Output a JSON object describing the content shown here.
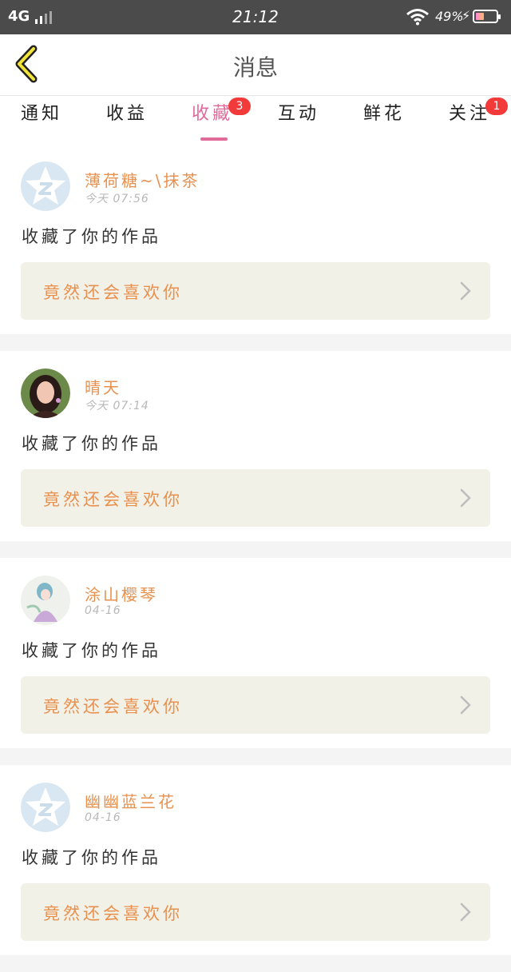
{
  "status_bar": {
    "network": "4G",
    "time": "21:12",
    "battery_percent": "49%",
    "battery_level": 0.49
  },
  "header": {
    "title": "消息",
    "back_icon": "back-chevron-icon"
  },
  "tabs": [
    {
      "label": "通知",
      "active": false,
      "badge": ""
    },
    {
      "label": "收益",
      "active": false,
      "badge": ""
    },
    {
      "label": "收藏",
      "active": true,
      "badge": "3"
    },
    {
      "label": "互动",
      "active": false,
      "badge": ""
    },
    {
      "label": "鲜花",
      "active": false,
      "badge": ""
    },
    {
      "label": "关注",
      "active": false,
      "badge": "1"
    }
  ],
  "colors": {
    "accent": "#e06a9a",
    "name_orange": "#e8914f",
    "badge_red": "#f23a3a",
    "link_bg": "#f2f1e8"
  },
  "feed": [
    {
      "user": "薄荷糖~\\抹茶",
      "time": "今天 07:56",
      "action": "收藏了你的作品",
      "work_title": "竟然还会喜欢你",
      "avatar": "default-star-avatar"
    },
    {
      "user": "晴天",
      "time": "今天 07:14",
      "action": "收藏了你的作品",
      "work_title": "竟然还会喜欢你",
      "avatar": "photo-avatar"
    },
    {
      "user": "涂山樱琴",
      "time": "04-16",
      "action": "收藏了你的作品",
      "work_title": "竟然还会喜欢你",
      "avatar": "anime-avatar"
    },
    {
      "user": "幽幽蓝兰花",
      "time": "04-16",
      "action": "收藏了你的作品",
      "work_title": "竟然还会喜欢你",
      "avatar": "default-star-avatar"
    }
  ]
}
